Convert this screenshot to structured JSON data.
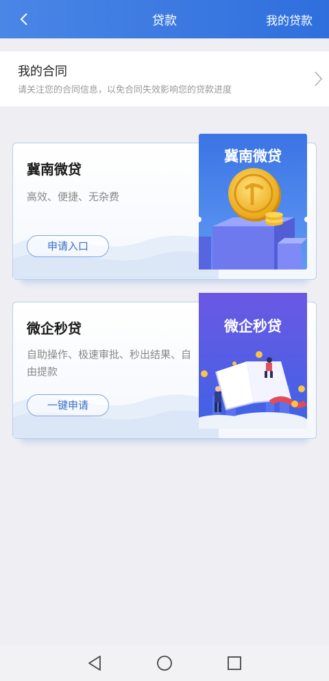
{
  "header": {
    "title": "贷款",
    "right_link": "我的贷款"
  },
  "contract": {
    "title": "我的合同",
    "subtitle": "请关注您的合同信息，以免合同失效影响您的贷款进度"
  },
  "cards": [
    {
      "title": "冀南微贷",
      "description": "高效、便捷、无杂费",
      "button": "申请入口",
      "image_text": "冀南微贷"
    },
    {
      "title": "微企秒贷",
      "description": "自助操作、极速审批、秒出结果、自由提款",
      "button": "一键申请",
      "image_text": "微企秒贷"
    }
  ],
  "colors": {
    "header": "#3a7ae2",
    "card_border": "#b9cdee",
    "button_text": "#3a6fc6"
  },
  "icons": {
    "back": "chevron-left",
    "contract_arrow": "chevron-right",
    "nav_back": "triangle-left",
    "nav_home": "circle",
    "nav_recent": "square"
  }
}
